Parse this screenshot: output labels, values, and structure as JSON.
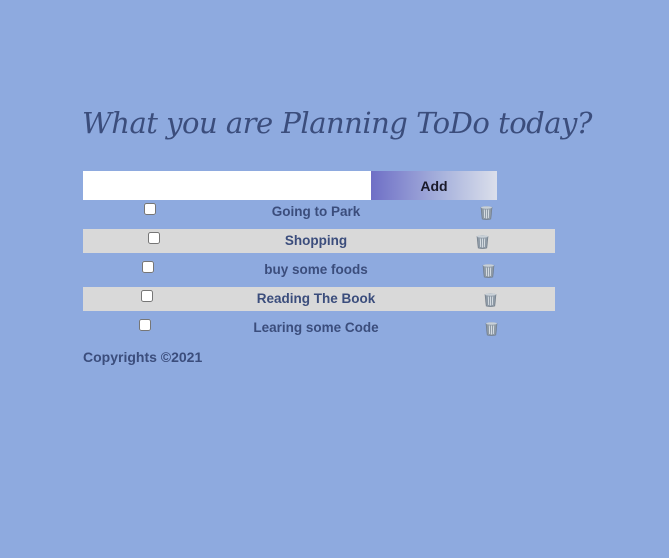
{
  "header": {
    "title": "What you are Planning ToDo today?"
  },
  "form": {
    "input_value": "",
    "add_label": "Add"
  },
  "todos": [
    {
      "text": "Going to Park",
      "checked": false,
      "delete_icon": "trash-icon"
    },
    {
      "text": "Shopping",
      "checked": false,
      "delete_icon": "trash-icon"
    },
    {
      "text": "buy some foods",
      "checked": false,
      "delete_icon": "trash-icon"
    },
    {
      "text": "Reading The Book",
      "checked": false,
      "delete_icon": "trash-icon"
    },
    {
      "text": "Learing some Code",
      "checked": false,
      "delete_icon": "trash-icon"
    }
  ],
  "footer": {
    "copyright": "Copyrights ©2021"
  },
  "colors": {
    "background": "#8eaadf",
    "text": "#3b4d7c",
    "row_shade": "#d9d9d9",
    "button_gradient_start": "#6f6fc6",
    "button_gradient_end": "#dbdfeb"
  }
}
